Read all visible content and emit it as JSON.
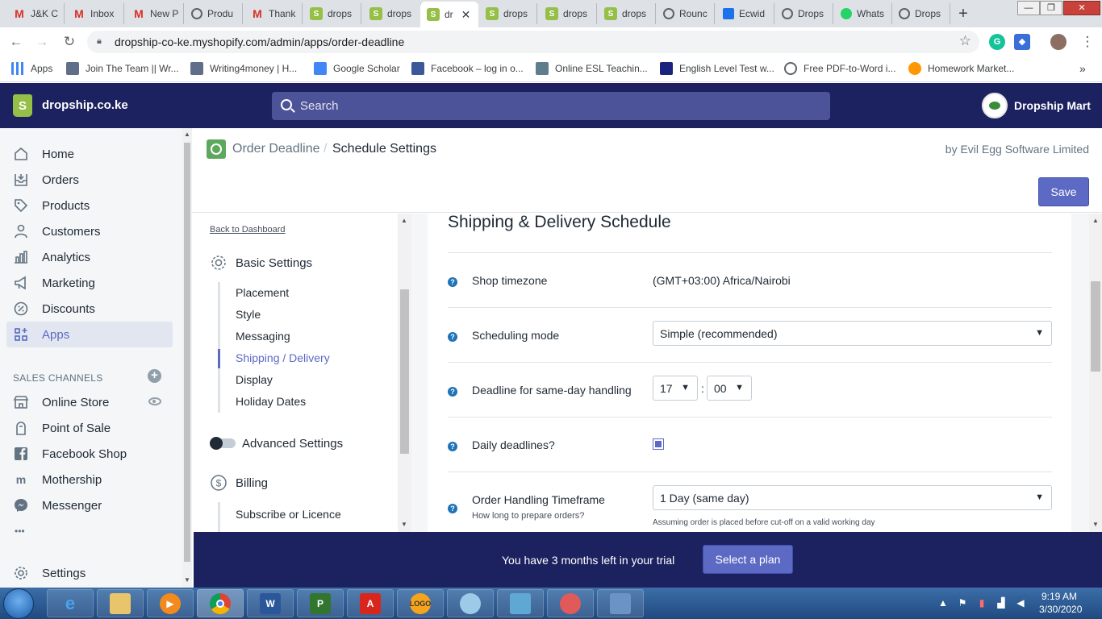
{
  "browser": {
    "tabs": [
      {
        "title": "J&K C",
        "icon": "gmail-icon"
      },
      {
        "title": "Inbox",
        "icon": "gmail-icon"
      },
      {
        "title": "New P",
        "icon": "gmail-icon"
      },
      {
        "title": "Produ",
        "icon": "globe-icon"
      },
      {
        "title": "Thank",
        "icon": "gmail-icon"
      },
      {
        "title": "drops",
        "icon": "shopify-icon"
      },
      {
        "title": "drops",
        "icon": "shopify-icon"
      },
      {
        "title": "dr",
        "icon": "shopify-icon"
      },
      {
        "title": "drops",
        "icon": "shopify-icon"
      },
      {
        "title": "drops",
        "icon": "shopify-icon"
      },
      {
        "title": "drops",
        "icon": "shopify-icon"
      },
      {
        "title": "Rounc",
        "icon": "globe-icon"
      },
      {
        "title": "Ecwid",
        "icon": "ecwid-icon"
      },
      {
        "title": "Drops",
        "icon": "globe-icon"
      },
      {
        "title": "Whats",
        "icon": "whatsapp-icon"
      },
      {
        "title": "Drops",
        "icon": "globe-icon"
      }
    ],
    "url": "dropship-co-ke.myshopify.com/admin/apps/order-deadline",
    "bookmarks": [
      "Apps",
      "Join The Team || Wr...",
      "Writing4money | H...",
      "Google Scholar",
      "Facebook – log in o...",
      "Online ESL Teachin...",
      "English Level Test w...",
      "Free PDF-to-Word i...",
      "Homework Market..."
    ]
  },
  "shopify": {
    "store_name": "dropship.co.ke",
    "search_placeholder": "Search",
    "account_name": "Dropship Mart",
    "nav": [
      {
        "label": "Home",
        "icon": "home-icon"
      },
      {
        "label": "Orders",
        "icon": "orders-icon"
      },
      {
        "label": "Products",
        "icon": "tag-icon"
      },
      {
        "label": "Customers",
        "icon": "person-icon"
      },
      {
        "label": "Analytics",
        "icon": "bar-chart-icon"
      },
      {
        "label": "Marketing",
        "icon": "megaphone-icon"
      },
      {
        "label": "Discounts",
        "icon": "discount-icon"
      },
      {
        "label": "Apps",
        "icon": "apps-icon",
        "active": true
      }
    ],
    "sales_channels_heading": "SALES CHANNELS",
    "channels": [
      {
        "label": "Online Store",
        "icon": "store-icon"
      },
      {
        "label": "Point of Sale",
        "icon": "pos-icon"
      },
      {
        "label": "Facebook Shop",
        "icon": "facebook-icon"
      },
      {
        "label": "Mothership",
        "icon": "mothership-icon"
      },
      {
        "label": "Messenger",
        "icon": "messenger-icon"
      }
    ],
    "more": "•••",
    "settings_label": "Settings"
  },
  "app": {
    "breadcrumb_app": "Order Deadline",
    "breadcrumb_sep": "/",
    "breadcrumb_page": "Schedule Settings",
    "by_line": "by Evil Egg Software Limited",
    "save_label": "Save",
    "back_link": "Back to Dashboard",
    "basic_settings": "Basic Settings",
    "basic_links": [
      "Placement",
      "Style",
      "Messaging",
      "Shipping / Delivery",
      "Display",
      "Holiday Dates"
    ],
    "active_link": "Shipping / Delivery",
    "advanced_settings": "Advanced Settings",
    "billing": "Billing",
    "billing_links": [
      "Subscribe or Licence"
    ]
  },
  "form": {
    "title": "Shipping & Delivery Schedule",
    "timezone_label": "Shop timezone",
    "timezone_value": "(GMT+03:00) Africa/Nairobi",
    "scheduling_label": "Scheduling mode",
    "scheduling_value": "Simple (recommended)",
    "deadline_label": "Deadline for same-day handling",
    "deadline_hour": "17",
    "deadline_minute": "00",
    "colon": ":",
    "daily_label": "Daily deadlines?",
    "daily_checked": true,
    "timeframe_label": "Order Handling Timeframe",
    "timeframe_sub": "How long to prepare orders?",
    "timeframe_value": "1 Day (same day)",
    "timeframe_hint": "Assuming order is placed before cut-off on a valid working day",
    "help_glyph": "?"
  },
  "trial": {
    "text": "You have 3 months left in your trial",
    "button": "Select a plan"
  },
  "taskbar": {
    "time": "9:19 AM",
    "date": "3/30/2020",
    "apps": [
      "ie-icon",
      "explorer-icon",
      "media-player-icon",
      "chrome-icon",
      "word-icon",
      "project-icon",
      "acrobat-icon",
      "logo-app-icon",
      "paint-icon",
      "photo-viewer-icon",
      "snipping-icon",
      "control-panel-icon"
    ]
  },
  "colors": {
    "topbar": "#1c2260",
    "accent": "#5c6ac4",
    "shopify_green": "#95bf47"
  }
}
